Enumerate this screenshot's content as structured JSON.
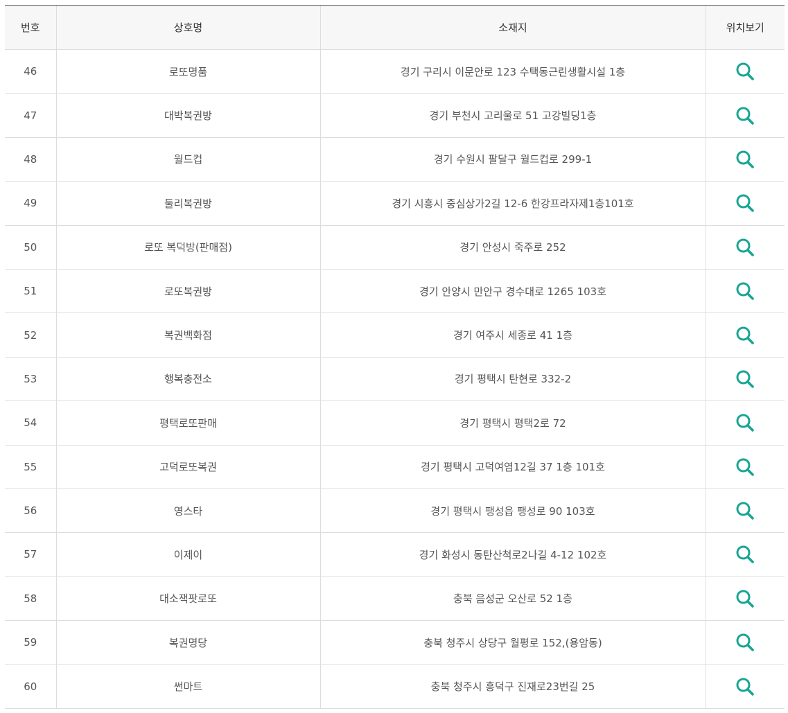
{
  "table": {
    "headers": [
      "번호",
      "상호명",
      "소재지",
      "위치보기"
    ],
    "rows": [
      {
        "no": "46",
        "name": "로또명품",
        "address": "경기 구리시 이문안로 123 수택동근린생활시설 1층"
      },
      {
        "no": "47",
        "name": "대박복권방",
        "address": "경기 부천시 고리울로 51 고강빌딩1층"
      },
      {
        "no": "48",
        "name": "월드컵",
        "address": "경기 수원시 팔달구 월드컵로 299-1"
      },
      {
        "no": "49",
        "name": "둘리복권방",
        "address": "경기 시흥시 중심상가2길 12-6 한강프라자제1층101호"
      },
      {
        "no": "50",
        "name": "로또 복덕방(판매점)",
        "address": "경기 안성시 죽주로 252"
      },
      {
        "no": "51",
        "name": "로또복권방",
        "address": "경기 안양시 만안구 경수대로 1265 103호"
      },
      {
        "no": "52",
        "name": "복권백화점",
        "address": "경기 여주시 세종로 41 1층"
      },
      {
        "no": "53",
        "name": "행복충전소",
        "address": "경기 평택시 탄현로 332-2"
      },
      {
        "no": "54",
        "name": "평택로또판매",
        "address": "경기 평택시 평택2로 72"
      },
      {
        "no": "55",
        "name": "고덕로또복권",
        "address": "경기 평택시 고덕여염12길 37 1층 101호"
      },
      {
        "no": "56",
        "name": "영스타",
        "address": "경기 평택시 팽성읍 팽성로 90 103호"
      },
      {
        "no": "57",
        "name": "이제이",
        "address": "경기 화성시 동탄산척로2나길 4-12 102호"
      },
      {
        "no": "58",
        "name": "대소잭팟로또",
        "address": "충북 음성군 오산로 52 1층"
      },
      {
        "no": "59",
        "name": "복권명당",
        "address": "충북 청주시 상당구 월평로 152,(용암동)"
      },
      {
        "no": "60",
        "name": "썬마트",
        "address": "충북 청주시 흥덕구 진재로23번길 25"
      }
    ],
    "map_icon": "search-icon"
  },
  "colors": {
    "accent": "#1aa595",
    "header_bg": "#f7f7f7",
    "border": "#dddddd",
    "top_border": "#555555",
    "text": "#555555"
  }
}
